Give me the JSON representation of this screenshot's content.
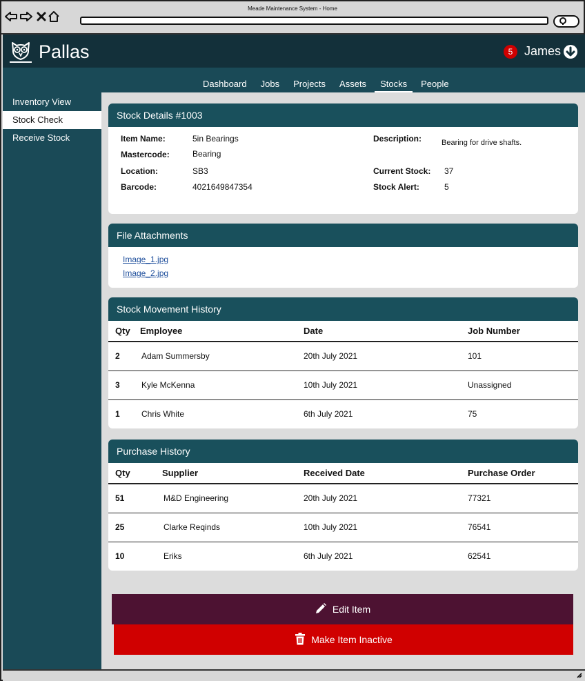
{
  "window": {
    "title": "Meade Maintenance System - Home"
  },
  "app": {
    "brand": "Pallas",
    "notification_count": "5",
    "user": "James"
  },
  "tabs": [
    "Dashboard",
    "Jobs",
    "Projects",
    "Assets",
    "Stocks",
    "People"
  ],
  "active_tab": "Stocks",
  "sidebar": {
    "items": [
      "Inventory View",
      "Stock Check",
      "Receive Stock"
    ],
    "active": "Stock Check"
  },
  "stock_details": {
    "title": "Stock Details #1003",
    "item_name_label": "Item Name:",
    "item_name": "5in Bearings",
    "mastercode_label": "Mastercode:",
    "mastercode": "Bearing",
    "location_label": "Location:",
    "location": "SB3",
    "barcode_label": "Barcode:",
    "barcode": "4021649847354",
    "description_label": "Description:",
    "description": "Bearing for drive shafts.",
    "current_stock_label": "Current Stock:",
    "current_stock": "37",
    "stock_alert_label": "Stock Alert:",
    "stock_alert": "5"
  },
  "attachments": {
    "title": "File Attachments",
    "files": [
      "Image_1.jpg",
      "Image_2.jpg"
    ]
  },
  "movement_history": {
    "title": "Stock Movement History",
    "columns": [
      "Qty",
      "Employee",
      "Date",
      "Job Number"
    ],
    "rows": [
      [
        "2",
        "Adam Summersby",
        "20th July 2021",
        "101"
      ],
      [
        "3",
        "Kyle McKenna",
        "10th July 2021",
        "Unassigned"
      ],
      [
        "1",
        "Chris White",
        "6th July 2021",
        "75"
      ]
    ]
  },
  "purchase_history": {
    "title": "Purchase History",
    "columns": [
      "Qty",
      "Supplier",
      "Received Date",
      "Purchase Order"
    ],
    "rows": [
      [
        "51",
        "M&D Engineering",
        "20th July 2021",
        "77321"
      ],
      [
        "25",
        "Clarke Reqinds",
        "10th July 2021",
        "76541"
      ],
      [
        "10",
        "Eriks",
        "6th July 2021",
        "62541"
      ]
    ]
  },
  "actions": {
    "edit_label": "Edit Item",
    "inactive_label": "Make Item Inactive"
  },
  "colors": {
    "header_dark": "#13303a",
    "nav_teal": "#1a4a57",
    "card_header": "#19505c",
    "edit_button": "#4d1232",
    "danger": "#d00000",
    "link": "#1f4f9c"
  },
  "icons": [
    "back-arrow-icon",
    "forward-arrow-icon",
    "stop-icon",
    "home-icon",
    "search-icon",
    "owl-logo-icon",
    "chevron-down-circle-icon",
    "pencil-icon",
    "trash-icon",
    "resize-grip-icon"
  ]
}
